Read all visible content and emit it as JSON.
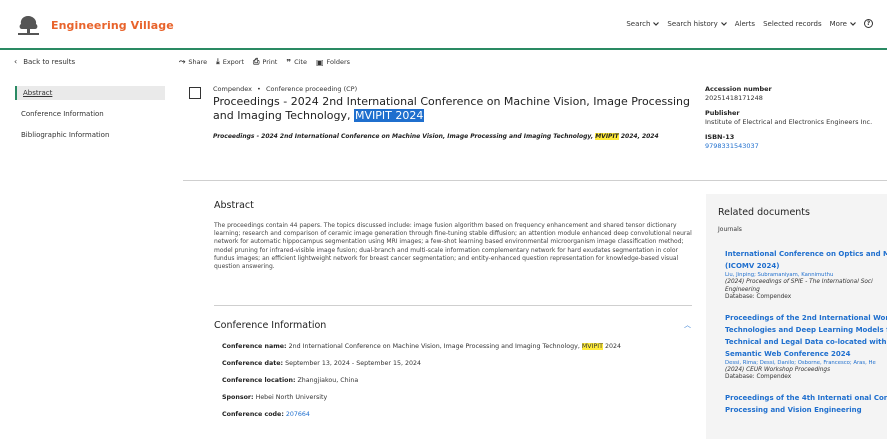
{
  "header": {
    "brand": "Engineering Village",
    "nav": [
      {
        "label": "Search",
        "has_dropdown": true
      },
      {
        "label": "Search history",
        "has_dropdown": true
      },
      {
        "label": "Alerts",
        "has_dropdown": false
      },
      {
        "label": "Selected records",
        "has_dropdown": false
      },
      {
        "label": "More",
        "has_dropdown": true
      }
    ],
    "help_icon": "question-circle-icon",
    "accent_color": "#2a8a63",
    "brand_color": "#e8632b"
  },
  "actionbar": {
    "back_label": "Back to results",
    "actions": [
      {
        "label": "Share",
        "icon": "share-icon"
      },
      {
        "label": "Export",
        "icon": "export-icon"
      },
      {
        "label": "Print",
        "icon": "print-icon"
      },
      {
        "label": "Cite",
        "icon": "quote-icon"
      },
      {
        "label": "Folders",
        "icon": "folder-add-icon"
      }
    ]
  },
  "leftnav": {
    "items": [
      {
        "label": "Abstract",
        "active": true
      },
      {
        "label": "Conference Information",
        "active": false
      },
      {
        "label": "Bibliographic Information",
        "active": false
      }
    ]
  },
  "record": {
    "database": "Compendex",
    "separator": "•",
    "doc_type": "Conference proceeding (CP)",
    "title_prefix": "Proceedings - 2024 2nd International Conference on Machine Vision, Image Processing and Imaging Technology,",
    "title_highlight": "MVIPIT 2024",
    "source_prefix": "Proceedings - 2024 2nd International Conference on Machine Vision, Image Processing and Imaging Technology,",
    "source_highlight": "MVIPIT",
    "source_suffix": "2024, 2024"
  },
  "right_info": {
    "accession_label": "Accession number",
    "accession_value": "20251418171248",
    "publisher_label": "Publisher",
    "publisher_value": "Institute of Electrical and Electronics Engineers Inc.",
    "isbn_label": "ISBN-13",
    "isbn_value": "9798331543037"
  },
  "abstract": {
    "heading": "Abstract",
    "text": "The proceedings contain 44 papers. The topics discussed include: image fusion algorithm based on frequency enhancement and shared tensor dictionary learning; research and comparison of ceramic image generation through fine-tuning stable diffusion; an attention module enhanced deep convolutional neural network for automatic hippocampus segmentation using MRI images; a few-shot learning based environmental microorganism image classification method; model pruning for infrared-visible image fusion; dual-branch and multi-scale information complementary network for hard exudates segmentation in color fundus images; an efficient lightweight network for breast cancer segmentation; and entity-enhanced question representation for knowledge-based visual question answering."
  },
  "conference": {
    "heading": "Conference Information",
    "name_label": "Conference name:",
    "name_prefix": "2nd International Conference on Machine Vision, Image Processing and Imaging Technology,",
    "name_highlight": "MVIPIT",
    "name_suffix": "2024",
    "date_label": "Conference date:",
    "date_value": "September 13, 2024 - September 15, 2024",
    "location_label": "Conference location:",
    "location_value": "Zhangjiakou, China",
    "sponsor_label": "Sponsor:",
    "sponsor_value": "Hebei North University",
    "code_label": "Conference code:",
    "code_value": "207664"
  },
  "related": {
    "heading": "Related documents",
    "subheading": "Journals",
    "items": [
      {
        "title_lines": [
          "International Conference on Optics and Ma",
          "(ICOMV 2024)"
        ],
        "authors": "Liu, Jinping; Subramaniyam, Kannimuthu",
        "source_lines": [
          "(2024) Proceedings of SPIE - The International Soci",
          "Engineering"
        ],
        "database": "Database: Compendex"
      },
      {
        "title_lines": [
          "Proceedings of the 2nd International Works",
          "Technologies and Deep Learning Models fo",
          "Technical and Legal Data co-located with t",
          "Semantic Web Conference 2024"
        ],
        "authors": "Dessi, Rima; Dessi, Danilo; Osborne, Francesco; Aras, He",
        "source_lines": [
          "(2024) CEUR Workshop Proceedings"
        ],
        "database": "Database: Compendex"
      },
      {
        "title_lines": [
          "Proceedings of the 4th Internati onal Confe",
          "Processing and Vision Engineering"
        ],
        "authors": "",
        "source_lines": [],
        "database": ""
      }
    ]
  }
}
